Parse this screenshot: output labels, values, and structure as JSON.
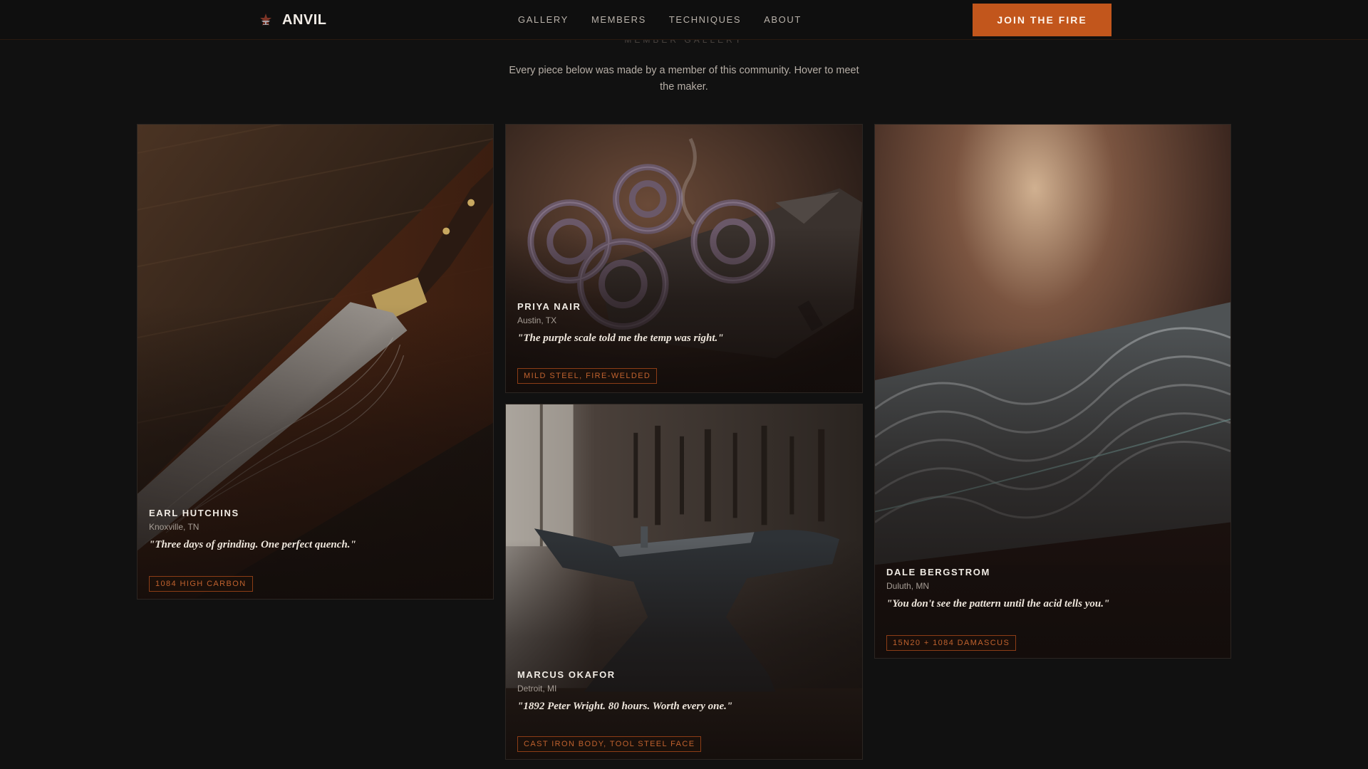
{
  "nav": {
    "brand": "ANVIL",
    "brand_icon": "anvil-icon",
    "links": [
      "GALLERY",
      "MEMBERS",
      "TECHNIQUES",
      "ABOUT"
    ],
    "cta": "JOIN THE FIRE"
  },
  "intro": {
    "eyebrow": "MEMBER GALLERY",
    "text": "Every piece below was made by a member of this community. Hover to meet the maker."
  },
  "cards": [
    {
      "maker": "EARL HUTCHINS",
      "location": "Knoxville, TN",
      "quote": "\"Three days of grinding. One perfect quench.\"",
      "tag": "1084 HIGH CARBON",
      "image": "damascus-chef-knife-photo"
    },
    {
      "maker": "PRIYA NAIR",
      "location": "Austin, TX",
      "quote": "\"The purple scale told me the temp was right.\"",
      "tag": "MILD STEEL, FIRE-WELDED",
      "image": "twisted-scroll-ironwork-photo"
    },
    {
      "maker": "MARCUS OKAFOR",
      "location": "Detroit, MI",
      "quote": "\"1892 Peter Wright. 80 hours. Worth every one.\"",
      "tag": "CAST IRON BODY, TOOL STEEL FACE",
      "image": "anvil-in-workshop-photo"
    },
    {
      "maker": "DALE BERGSTROM",
      "location": "Duluth, MN",
      "quote": "\"You don't see the pattern until the acid tells you.\"",
      "tag": "15N20 + 1084 DAMASCUS",
      "image": "damascus-etch-closeup-photo"
    }
  ],
  "colors": {
    "background": "#111111",
    "accent": "#c2561c",
    "tag_border": "#8c3d16",
    "tag_text": "#c0622e"
  }
}
